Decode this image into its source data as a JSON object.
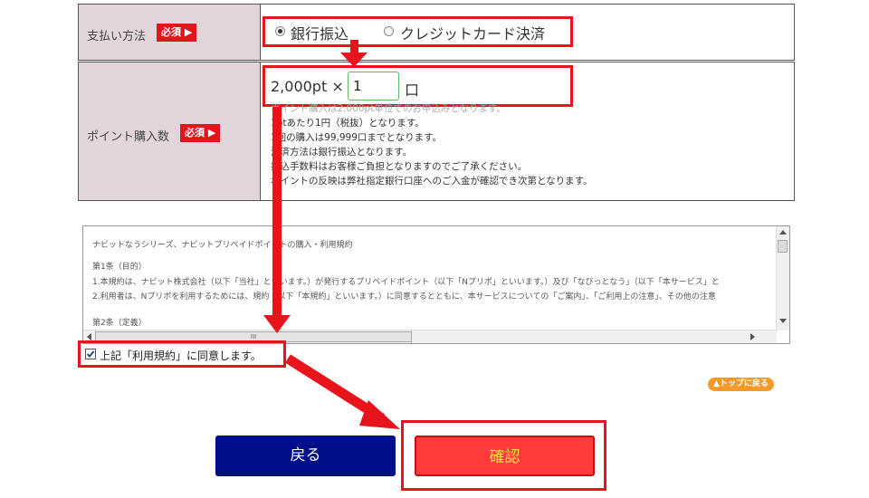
{
  "payment": {
    "label": "支払い方法",
    "required_badge": "必須 ▶",
    "options": [
      {
        "label": "銀行振込",
        "selected": true
      },
      {
        "label": "クレジットカード決済",
        "selected": false
      }
    ]
  },
  "points": {
    "label": "ポイント購入数",
    "required_badge": "必須 ▶",
    "unit_price": "2,000pt ×",
    "quantity": "1",
    "unit": "口",
    "notes": [
      "ポイント購入は2,000pt単位でのお申込みとなります。",
      "1ptあたり1円（税抜）となります。",
      "1回の購入は99,999口までとなります。",
      "決済方法は銀行振込となります。",
      "振込手数料はお客様ご負担となりますのでご了承ください。",
      "ポイントの反映は弊社指定銀行口座へのご入金が確認でき次第となります。"
    ]
  },
  "terms": {
    "title": "ナビットなうシリーズ、ナビットプリペイドポイントの購入・利用規約",
    "lines": [
      "第1条（目的）",
      "1.本規約は、ナビット株式会社（以下「当社」といいます。）が発行するプリペイドポイント（以下「Nプリポ」といいます。）及び「なびっとなう」（以下「本サービス」と",
      "2.利用者は、Nプリポを利用するためには、規約（以下「本規約」といいます。）に同意するとともに、本サービスについての「ご案内」、「ご利用上の注意」、その他の注意",
      "第2条（定義）"
    ],
    "scroll_grip": "III"
  },
  "agree": {
    "label": "上記「利用規約」に同意します。",
    "checked": true
  },
  "to_top": "▲トップに戻る",
  "buttons": {
    "back": "戻る",
    "confirm": "確認"
  },
  "colors": {
    "accent_red": "#e8141b",
    "back_button": "#000e8a",
    "confirm_button": "#ff3b3b",
    "confirm_text": "#ffe14a",
    "label_bg": "#e2d5dc",
    "to_top_orange": "#f39a2a"
  }
}
